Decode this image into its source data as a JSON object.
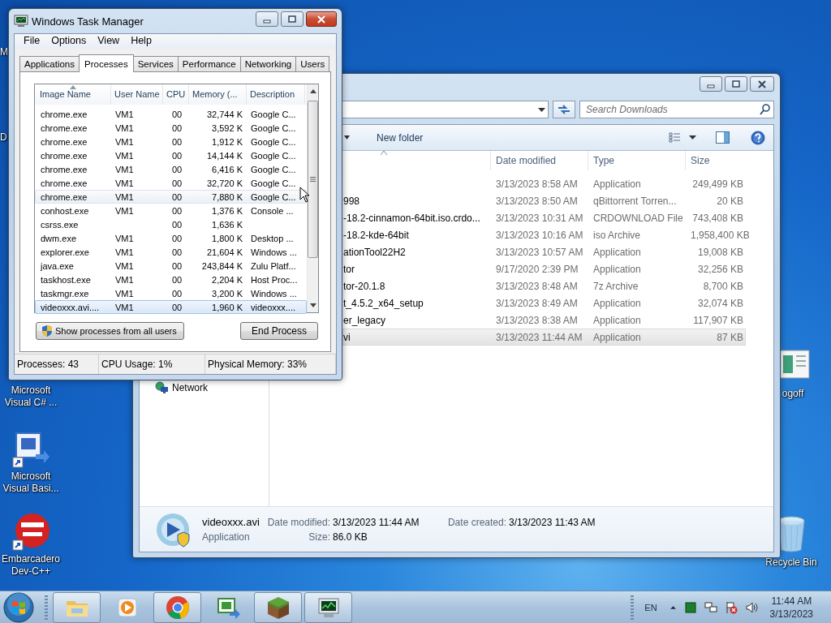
{
  "desktop": {
    "icons": [
      {
        "label": "M"
      },
      {
        "label": "D"
      },
      {
        "label": "Microsoft Visual C# ..."
      },
      {
        "label": "Microsoft Visual Basi...",
        "kind": "vb"
      },
      {
        "label": "Embarcadero Dev-C++",
        "kind": "devcpp"
      },
      {
        "label": "ogoff",
        "kind": "logoff"
      },
      {
        "label": "Recycle Bin",
        "kind": "recycle"
      }
    ]
  },
  "explorer": {
    "search": {
      "placeholder": "Search Downloads"
    },
    "toolbar": [
      "New folder"
    ],
    "columns": [
      "Date modified",
      "Type",
      "Size"
    ],
    "files": [
      {
        "date": "3/13/2023 8:58 AM",
        "type": "Application",
        "size": "249,499 KB",
        "selected": false
      },
      {
        "name": "998",
        "date": "3/13/2023 8:50 AM",
        "type": "qBittorrent Torren...",
        "size": "20 KB",
        "selected": false
      },
      {
        "name": "-18.2-cinnamon-64bit.iso.crdo...",
        "date": "3/13/2023 10:31 AM",
        "type": "CRDOWNLOAD File",
        "size": "743,408 KB",
        "selected": false
      },
      {
        "name": "-18.2-kde-64bit",
        "date": "3/13/2023 10:16 AM",
        "type": "iso Archive",
        "size": "1,958,400 KB",
        "selected": false
      },
      {
        "name": "ationTool22H2",
        "date": "3/13/2023 10:57 AM",
        "type": "Application",
        "size": "19,008 KB",
        "selected": false
      },
      {
        "name": "tor",
        "date": "9/17/2020 2:39 PM",
        "type": "Application",
        "size": "32,256 KB",
        "selected": false
      },
      {
        "name": "tor-20.1.8",
        "date": "3/13/2023 8:48 AM",
        "type": "7z Archive",
        "size": "8,700 KB",
        "selected": false
      },
      {
        "name": "t_4.5.2_x64_setup",
        "date": "3/13/2023 8:49 AM",
        "type": "Application",
        "size": "32,074 KB",
        "selected": false
      },
      {
        "name": "er_legacy",
        "date": "3/13/2023 8:38 AM",
        "type": "Application",
        "size": "117,907 KB",
        "selected": false
      },
      {
        "name": "vi",
        "date": "3/13/2023 11:44 AM",
        "type": "Application",
        "size": "87 KB",
        "selected": true
      }
    ],
    "nav": [
      "Network"
    ],
    "details": {
      "name": "videoxxx.avi",
      "type": "Application",
      "fields": [
        {
          "label": "Date modified:",
          "value": "3/13/2023 11:44 AM"
        },
        {
          "label": "Date created:",
          "value": "3/13/2023 11:43 AM"
        },
        {
          "label": "Size:",
          "value": "86.0 KB"
        }
      ]
    }
  },
  "task_manager": {
    "title": "Windows Task Manager",
    "menu": [
      "File",
      "Options",
      "View",
      "Help"
    ],
    "tabs": [
      {
        "label": "Applications",
        "selected": false
      },
      {
        "label": "Processes",
        "selected": true
      },
      {
        "label": "Services",
        "selected": false
      },
      {
        "label": "Performance",
        "selected": false
      },
      {
        "label": "Networking",
        "selected": false
      },
      {
        "label": "Users",
        "selected": false
      }
    ],
    "columns": [
      "Image Name",
      "User Name",
      "CPU",
      "Memory (...",
      "Description"
    ],
    "rows": [
      {
        "image": "chrome.exe",
        "user": "VM1",
        "cpu": "00",
        "memory": "32,744 K",
        "description": "Google C...",
        "selected": false,
        "hovered": false
      },
      {
        "image": "chrome.exe",
        "user": "VM1",
        "cpu": "00",
        "memory": "3,592 K",
        "description": "Google C...",
        "selected": false,
        "hovered": false
      },
      {
        "image": "chrome.exe",
        "user": "VM1",
        "cpu": "00",
        "memory": "1,912 K",
        "description": "Google C...",
        "selected": false,
        "hovered": false
      },
      {
        "image": "chrome.exe",
        "user": "VM1",
        "cpu": "00",
        "memory": "14,144 K",
        "description": "Google C...",
        "selected": false,
        "hovered": false
      },
      {
        "image": "chrome.exe",
        "user": "VM1",
        "cpu": "00",
        "memory": "6,416 K",
        "description": "Google C...",
        "selected": false,
        "hovered": false
      },
      {
        "image": "chrome.exe",
        "user": "VM1",
        "cpu": "00",
        "memory": "32,720 K",
        "description": "Google C...",
        "selected": false,
        "hovered": false
      },
      {
        "image": "chrome.exe",
        "user": "VM1",
        "cpu": "00",
        "memory": "7,880 K",
        "description": "Google C...",
        "selected": false,
        "hovered": true
      },
      {
        "image": "conhost.exe",
        "user": "VM1",
        "cpu": "00",
        "memory": "1,376 K",
        "description": "Console ...",
        "selected": false,
        "hovered": false
      },
      {
        "image": "csrss.exe",
        "cpu": "00",
        "memory": "1,636 K",
        "selected": false,
        "hovered": false
      },
      {
        "image": "dwm.exe",
        "user": "VM1",
        "cpu": "00",
        "memory": "1,800 K",
        "description": "Desktop ...",
        "selected": false,
        "hovered": false
      },
      {
        "image": "explorer.exe",
        "user": "VM1",
        "cpu": "00",
        "memory": "21,604 K",
        "description": "Windows ...",
        "selected": false,
        "hovered": false
      },
      {
        "image": "java.exe",
        "user": "VM1",
        "cpu": "00",
        "memory": "243,844 K",
        "description": "Zulu Platf...",
        "selected": false,
        "hovered": false
      },
      {
        "image": "taskhost.exe",
        "user": "VM1",
        "cpu": "00",
        "memory": "2,204 K",
        "description": "Host Proc...",
        "selected": false,
        "hovered": false
      },
      {
        "image": "taskmgr.exe",
        "user": "VM1",
        "cpu": "00",
        "memory": "3,200 K",
        "description": "Windows ...",
        "selected": false,
        "hovered": false
      },
      {
        "image": "videoxxx.avi....",
        "user": "VM1",
        "cpu": "00",
        "memory": "1,960 K",
        "description": "videoxxx....",
        "selected": true,
        "hovered": false
      }
    ],
    "buttons": [
      {
        "label": "Show processes from all users",
        "kind": "shield"
      },
      {
        "label": "End Process"
      }
    ],
    "status": [
      "Processes: 43",
      "CPU Usage: 1%",
      "Physical Memory: 33%"
    ]
  },
  "taskbar": {
    "apps": [
      {
        "kind": "folder",
        "running": true
      },
      {
        "kind": "media",
        "running": false
      },
      {
        "kind": "chrome",
        "running": true
      },
      {
        "kind": "csharp",
        "running": false
      },
      {
        "kind": "grass",
        "running": true
      },
      {
        "kind": "taskmgr",
        "running": true
      }
    ],
    "tray": {
      "language": "EN",
      "time": "11:44 AM",
      "date": "3/13/2023"
    }
  }
}
